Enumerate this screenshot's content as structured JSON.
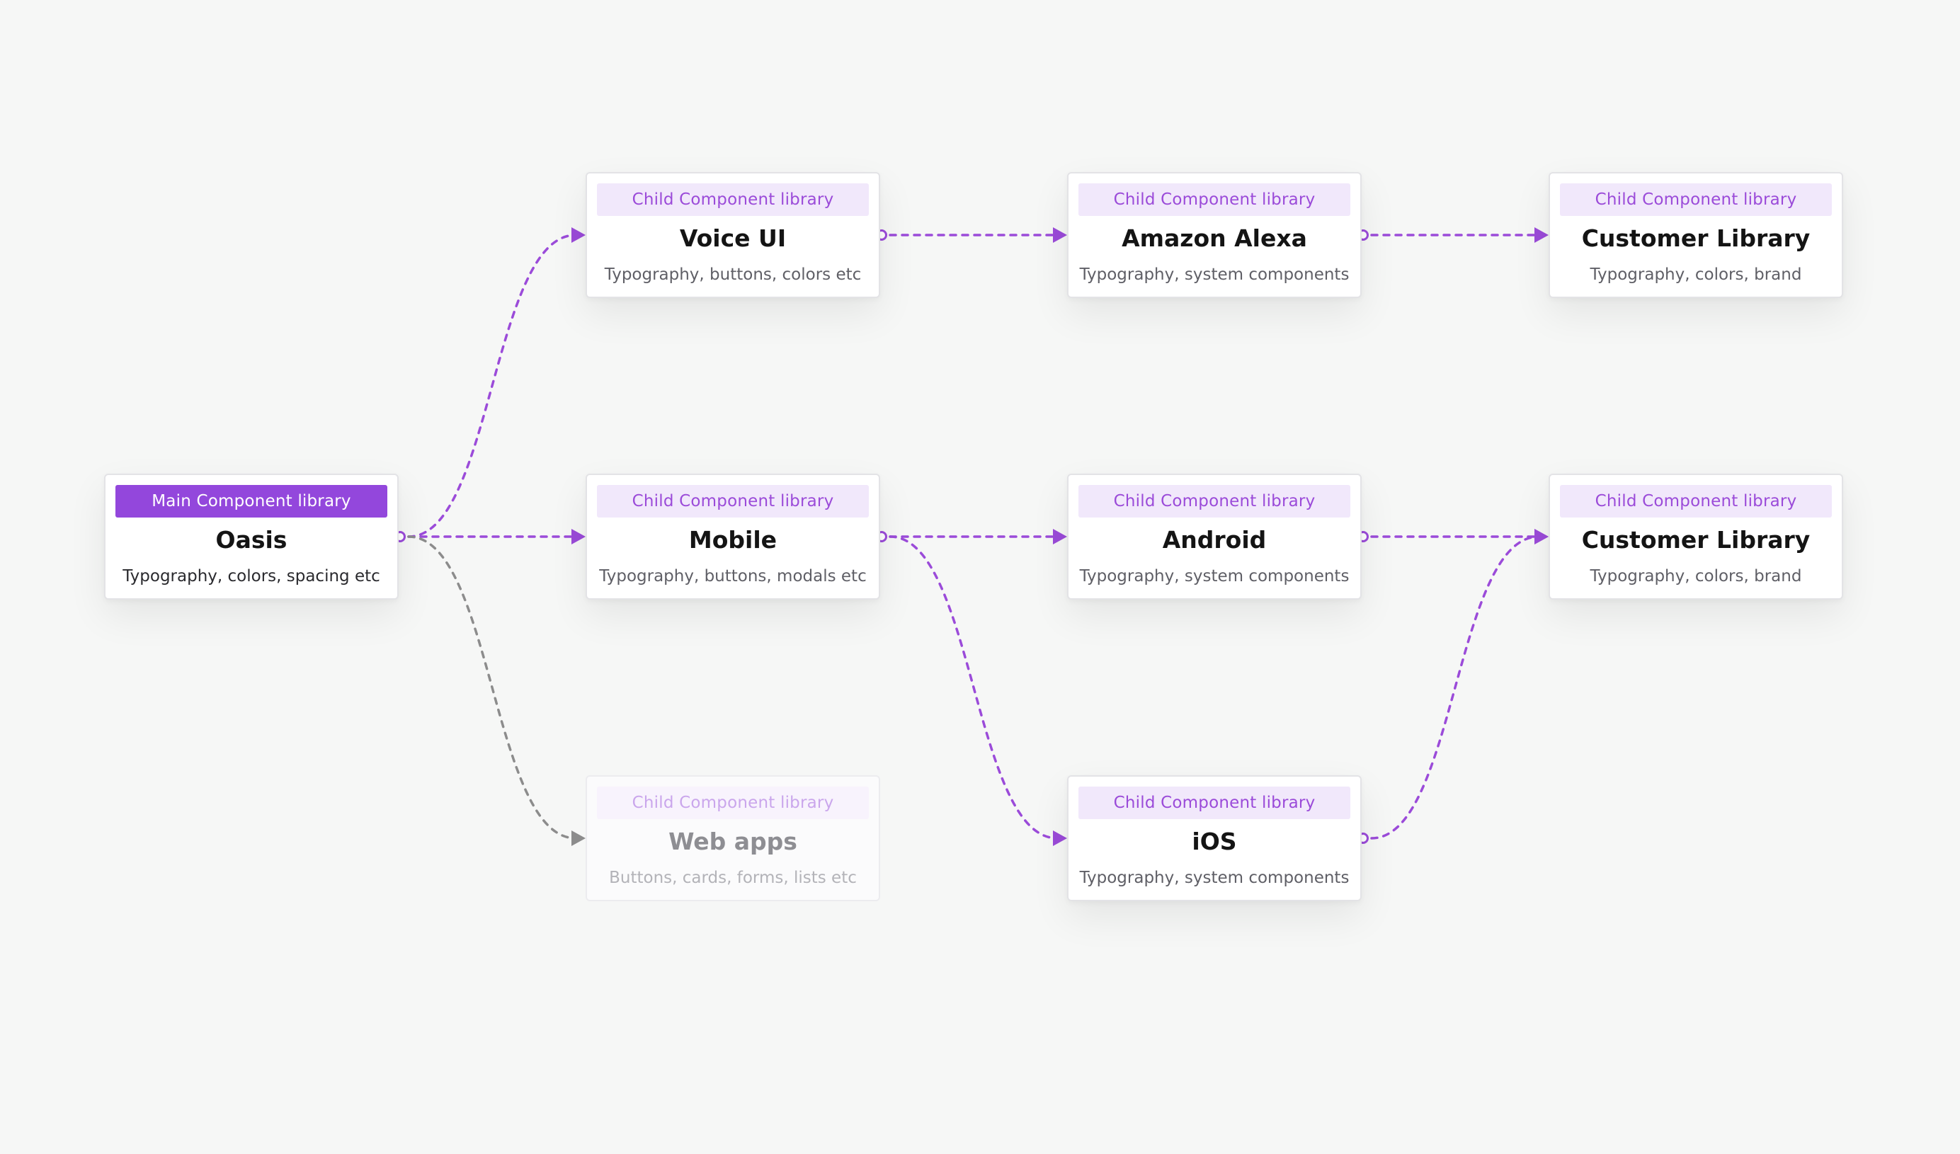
{
  "colors": {
    "accent": "#9b4bd9",
    "accent_strong": "#9347dc",
    "muted_edge": "#8c8c8c",
    "background": "#f6f7f6"
  },
  "nodes": [
    {
      "id": "oasis",
      "tag": "Main Component library",
      "title": "Oasis",
      "desc": "Typography, colors, spacing etc",
      "variant": "main"
    },
    {
      "id": "voice-ui",
      "tag": "Child Component library",
      "title": "Voice UI",
      "desc": "Typography, buttons, colors etc",
      "variant": "child"
    },
    {
      "id": "mobile",
      "tag": "Child Component library",
      "title": "Mobile",
      "desc": "Typography, buttons, modals etc",
      "variant": "child"
    },
    {
      "id": "web-apps",
      "tag": "Child Component library",
      "title": "Web apps",
      "desc": "Buttons, cards, forms, lists etc",
      "variant": "faded"
    },
    {
      "id": "amazon-alexa",
      "tag": "Child Component library",
      "title": "Amazon Alexa",
      "desc": "Typography, system components",
      "variant": "child"
    },
    {
      "id": "android",
      "tag": "Child Component library",
      "title": "Android",
      "desc": "Typography, system components",
      "variant": "child"
    },
    {
      "id": "ios",
      "tag": "Child Component library",
      "title": "iOS",
      "desc": "Typography, system components",
      "variant": "child"
    },
    {
      "id": "customer-library-1",
      "tag": "Child Component library",
      "title": "Customer Library",
      "desc": "Typography, colors, brand",
      "variant": "child"
    },
    {
      "id": "customer-library-2",
      "tag": "Child Component library",
      "title": "Customer Library",
      "desc": "Typography, colors, brand",
      "variant": "child"
    }
  ],
  "edges": [
    {
      "from": "oasis",
      "to": "voice-ui",
      "muted": false
    },
    {
      "from": "oasis",
      "to": "mobile",
      "muted": false
    },
    {
      "from": "oasis",
      "to": "web-apps",
      "muted": true
    },
    {
      "from": "voice-ui",
      "to": "amazon-alexa",
      "muted": false
    },
    {
      "from": "mobile",
      "to": "android",
      "muted": false
    },
    {
      "from": "mobile",
      "to": "ios",
      "muted": false
    },
    {
      "from": "amazon-alexa",
      "to": "customer-library-1",
      "muted": false
    },
    {
      "from": "android",
      "to": "customer-library-2",
      "muted": false
    },
    {
      "from": "ios",
      "to": "customer-library-2",
      "muted": false
    }
  ]
}
